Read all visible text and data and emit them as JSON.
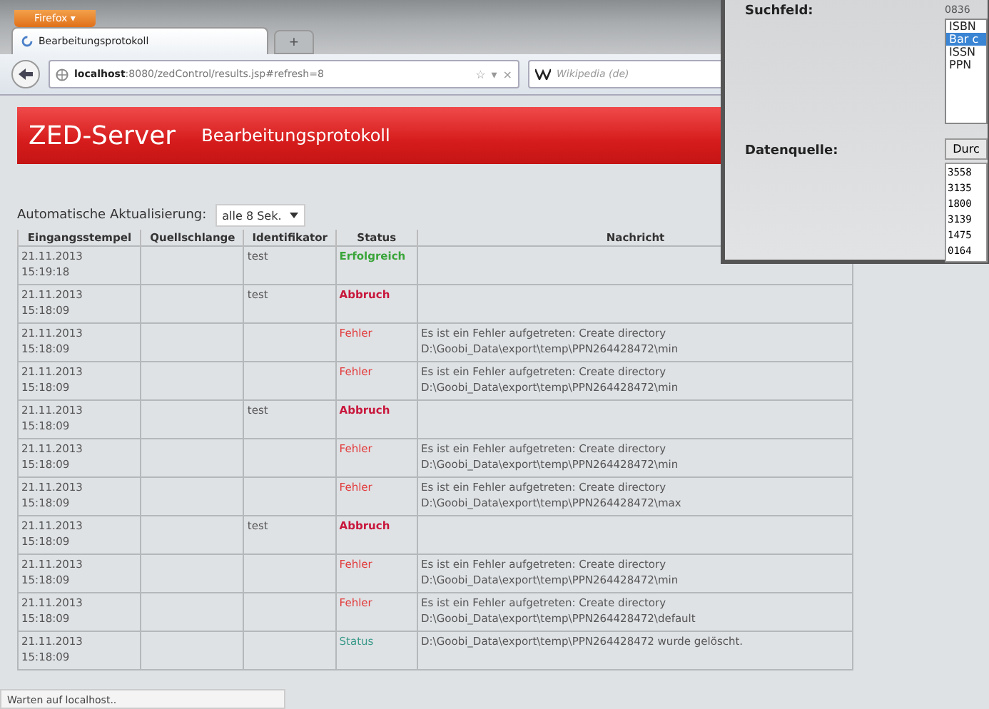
{
  "browser": {
    "menu_button": "Firefox ▾",
    "tabs": [
      {
        "label": "Bearbeitungsprotokoll",
        "selected": true
      }
    ],
    "new_tab": "+",
    "address": {
      "host": "localhost",
      "rest": ":8080/zedControl/results.jsp#refresh=8"
    },
    "address_icons": [
      "☆",
      "▾",
      "×"
    ],
    "search": {
      "placeholder": "Wikipedia (de)"
    },
    "status": "Warten auf localhost.."
  },
  "page": {
    "title": "ZED-Server",
    "subtitle": "Bearbeitungsprotokoll",
    "refresh_label": "Automatische Aktualisierung:",
    "refresh_value": "alle 8 Sek.",
    "table": {
      "columns": [
        "Eingangsstempel",
        "Quellschlange",
        "Identifikator",
        "Status",
        "Nachricht"
      ],
      "rows": [
        {
          "date": "21.11.2013",
          "time": "15:19:18",
          "source": "",
          "id": "test",
          "status": "Erfolgreich",
          "kind": "success",
          "message": ""
        },
        {
          "date": "21.11.2013",
          "time": "15:18:09",
          "source": "",
          "id": "test",
          "status": "Abbruch",
          "kind": "abort",
          "message": ""
        },
        {
          "date": "21.11.2013",
          "time": "15:18:09",
          "source": "",
          "id": "",
          "status": "Fehler",
          "kind": "error",
          "message": "Es ist ein Fehler aufgetreten: Create directory D:\\Goobi_Data\\export\\temp\\PPN264428472\\min"
        },
        {
          "date": "21.11.2013",
          "time": "15:18:09",
          "source": "",
          "id": "",
          "status": "Fehler",
          "kind": "error",
          "message": "Es ist ein Fehler aufgetreten: Create directory D:\\Goobi_Data\\export\\temp\\PPN264428472\\min"
        },
        {
          "date": "21.11.2013",
          "time": "15:18:09",
          "source": "",
          "id": "test",
          "status": "Abbruch",
          "kind": "abort",
          "message": ""
        },
        {
          "date": "21.11.2013",
          "time": "15:18:09",
          "source": "",
          "id": "",
          "status": "Fehler",
          "kind": "error",
          "message": "Es ist ein Fehler aufgetreten: Create directory D:\\Goobi_Data\\export\\temp\\PPN264428472\\min"
        },
        {
          "date": "21.11.2013",
          "time": "15:18:09",
          "source": "",
          "id": "",
          "status": "Fehler",
          "kind": "error",
          "message": "Es ist ein Fehler aufgetreten: Create directory D:\\Goobi_Data\\export\\temp\\PPN264428472\\max"
        },
        {
          "date": "21.11.2013",
          "time": "15:18:09",
          "source": "",
          "id": "test",
          "status": "Abbruch",
          "kind": "abort",
          "message": ""
        },
        {
          "date": "21.11.2013",
          "time": "15:18:09",
          "source": "",
          "id": "",
          "status": "Fehler",
          "kind": "error",
          "message": "Es ist ein Fehler aufgetreten: Create directory D:\\Goobi_Data\\export\\temp\\PPN264428472\\min"
        },
        {
          "date": "21.11.2013",
          "time": "15:18:09",
          "source": "",
          "id": "",
          "status": "Fehler",
          "kind": "error",
          "message": "Es ist ein Fehler aufgetreten: Create directory D:\\Goobi_Data\\export\\temp\\PPN264428472\\default"
        },
        {
          "date": "21.11.2013",
          "time": "15:18:09",
          "source": "",
          "id": "",
          "status": "Status",
          "kind": "info",
          "message": "D:\\Goobi_Data\\export\\temp\\PPN264428472 wurde gelöscht."
        }
      ]
    }
  },
  "dialog": {
    "search_label": "Suchfeld:",
    "search_value": "0836",
    "fields": [
      {
        "label": "ISBN",
        "selected": false
      },
      {
        "label": "Bar c",
        "selected": true
      },
      {
        "label": "ISSN",
        "selected": false
      },
      {
        "label": "PPN",
        "selected": false
      }
    ],
    "source_label": "Datenquelle:",
    "browse_button": "Durc",
    "numbers": [
      "3558",
      "3135",
      "1800",
      "3139",
      "1475",
      "0164"
    ]
  }
}
